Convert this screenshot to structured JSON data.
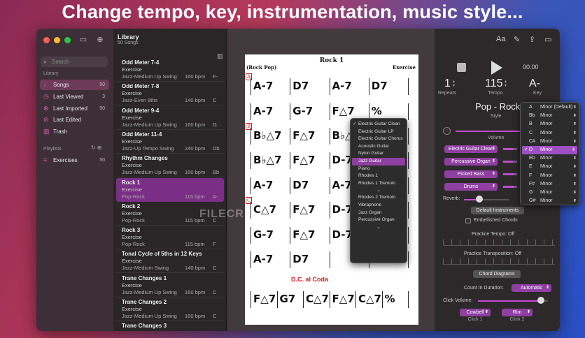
{
  "headline": "Change tempo, key, instrumentation, music style...",
  "colors": {
    "accent": "#8e3fa1",
    "selected_song": "#7b2e85",
    "sidebar_icon": "#e05fb5",
    "traffic_red": "#fe5f57",
    "traffic_yellow": "#febc2e",
    "traffic_green": "#28c840"
  },
  "sidebar": {
    "search_placeholder": "Search",
    "library_label": "Library",
    "items": [
      {
        "label": "Songs",
        "count": "50",
        "icon": "music-note-icon",
        "selected": true
      },
      {
        "label": "Last Viewed",
        "count": "3",
        "icon": "clock-icon"
      },
      {
        "label": "Last Imported",
        "count": "50",
        "icon": "import-icon"
      },
      {
        "label": "Last Edited",
        "count": "",
        "icon": "edit-icon"
      },
      {
        "label": "Trash",
        "count": "",
        "icon": "trash-icon"
      }
    ],
    "playlists_label": "Playlists",
    "playlists": [
      {
        "label": "Exercises",
        "count": "50",
        "icon": "playlist-icon"
      }
    ]
  },
  "library": {
    "title": "Library",
    "subtitle": "50 Songs",
    "songs": [
      {
        "name": "Odd Meter 7-4",
        "type": "Exercise",
        "style": "Jazz-Medium Up Swing",
        "bpm": "160 bpm",
        "key": "F-"
      },
      {
        "name": "Odd Meter 7-8",
        "type": "Exercise",
        "style": "Jazz-Even 8ths",
        "bpm": "140 bpm",
        "key": "C"
      },
      {
        "name": "Odd Meter 9-4",
        "type": "Exercise",
        "style": "Jazz-Medium Up Swing",
        "bpm": "160 bpm",
        "key": "G"
      },
      {
        "name": "Odd Meter 11-4",
        "type": "Exercise",
        "style": "Jazz-Up Tempo Swing",
        "bpm": "240 bpm",
        "key": "Db"
      },
      {
        "name": "Rhythm Changes",
        "type": "Exercise",
        "style": "Jazz-Medium Up Swing",
        "bpm": "160 bpm",
        "key": "Bb"
      },
      {
        "name": "Rock 1",
        "type": "Exercise",
        "style": "Pop-Rock",
        "bpm": "115 bpm",
        "key": "A-",
        "selected": true
      },
      {
        "name": "Rock 2",
        "type": "Exercise",
        "style": "Pop-Rock",
        "bpm": "115 bpm",
        "key": "C"
      },
      {
        "name": "Rock 3",
        "type": "Exercise",
        "style": "Pop-Rock",
        "bpm": "115 bpm",
        "key": "F"
      },
      {
        "name": "Tonal Cycle of 5ths in 12 Keys",
        "type": "Exercise",
        "style": "Jazz-Medium Swing",
        "bpm": "140 bpm",
        "key": "C"
      },
      {
        "name": "Trane Changes 1",
        "type": "Exercise",
        "style": "Jazz-Medium Up Swing",
        "bpm": "160 bpm",
        "key": "C"
      },
      {
        "name": "Trane Changes 2",
        "type": "Exercise",
        "style": "Jazz-Medium Up Swing",
        "bpm": "160 bpm",
        "key": "C"
      },
      {
        "name": "Trane Changes 3",
        "type": "",
        "style": "",
        "bpm": "",
        "key": ""
      }
    ]
  },
  "sheet": {
    "title": "Rock 1",
    "style": "(Rock Pop)",
    "type": "Exercise",
    "rows": [
      [
        "A-7",
        "D7",
        "A-7",
        "D7"
      ],
      [
        "A-7",
        "G-7",
        "F△7",
        "%"
      ],
      [
        "B♭△7",
        "F△7",
        "B♭△7",
        "F△7"
      ],
      [
        "B♭△7",
        "F△7",
        "D-7",
        "E7"
      ],
      [
        "A-7",
        "D7",
        "A-7",
        "D7"
      ],
      [
        "C△7",
        "F△7",
        "D-7",
        "E7"
      ],
      [
        "G-7",
        "F△7",
        "D-7",
        "E7"
      ],
      [
        "A-7",
        "D7",
        "",
        ""
      ],
      [
        "F△7",
        "G7",
        "C△7",
        "F△7",
        "C△7",
        "%"
      ]
    ],
    "rehearsal_marks": [
      "A",
      "B",
      "C"
    ],
    "bracket_1": "1.",
    "bracket_2": "2.",
    "coda": "D.C. al Coda"
  },
  "watermark": "FILECR",
  "instrument_menu": {
    "options": [
      {
        "label": "Electric Guitar Clean",
        "checked": true
      },
      {
        "label": "Electric Guitar LP"
      },
      {
        "label": "Electric Guitar Chorus"
      },
      {
        "label": "Acoustic Guitar"
      },
      {
        "label": "Nylon Guitar"
      },
      {
        "label": "Jazz Guitar",
        "highlighted": true
      },
      {
        "label": "Piano"
      },
      {
        "label": "Rhodes 1"
      },
      {
        "label": "Rhodes 1 Tremolo"
      },
      {
        "label": "⌄",
        "arrow": true
      },
      {
        "label": "Rhodes 2 Tremolo"
      },
      {
        "label": "Vibraphone"
      },
      {
        "label": "Jazz Organ"
      },
      {
        "label": "Percussive Organ"
      },
      {
        "label": "⌄",
        "arrow": true
      }
    ]
  },
  "panel": {
    "time": "00:00",
    "repeats_value": "1",
    "repeats_label": "Repeats",
    "tempo_value": "115",
    "tempo_label": "Tempo",
    "key_value": "A-",
    "key_label": "Key",
    "style_value": "Pop - Rock",
    "style_label": "Style",
    "volume_label": "Volume",
    "volume_level": 0.85,
    "instruments": [
      {
        "label": "Electric Guitar Clean"
      },
      {
        "label": "Percussive Organ"
      },
      {
        "label": "Picked Bass"
      },
      {
        "label": "Drums"
      }
    ],
    "reverb_label": "Reverb:",
    "reverb_level": 0.35,
    "default_instruments": "Default Instruments",
    "embellished_chords": "Embellished Chords",
    "practice_tempo": "Practice Tempo: Off",
    "practice_transposition": "Practice Transposition: Off",
    "chord_diagrams": "Chord Diagrams",
    "count_in_label": "Count In Duration:",
    "count_in_value": "Automatic",
    "click_volume_label": "Click Volume:",
    "click_volume_level": 0.9,
    "click1_value": "Cowbell",
    "click1_label": "Click 1",
    "click2_value": "Rim",
    "click2_label": "Click 2"
  },
  "key_menu": {
    "keys": [
      {
        "note": "A",
        "mode": "Minor (Default)"
      },
      {
        "note": "Bb",
        "mode": "Minor"
      },
      {
        "note": "B",
        "mode": "Minor"
      },
      {
        "note": "C",
        "mode": "Minor"
      },
      {
        "note": "C#",
        "mode": "Minor"
      },
      {
        "note": "D",
        "mode": "Minor",
        "checked": true
      },
      {
        "note": "Eb",
        "mode": "Minor"
      },
      {
        "note": "E",
        "mode": "Minor"
      },
      {
        "note": "F",
        "mode": "Minor"
      },
      {
        "note": "F#",
        "mode": "Minor"
      },
      {
        "note": "G",
        "mode": "Minor"
      },
      {
        "note": "G#",
        "mode": "Minor"
      }
    ]
  }
}
